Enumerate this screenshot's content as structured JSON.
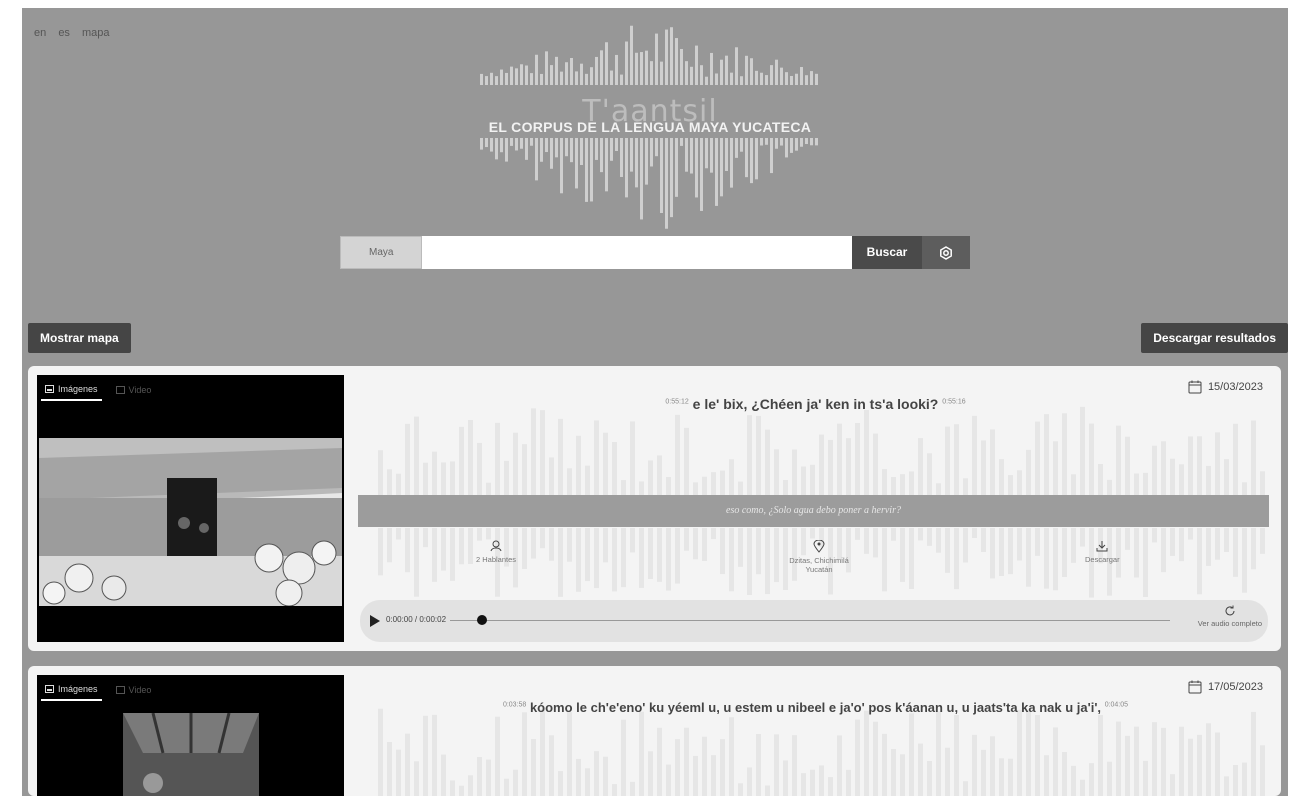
{
  "nav": {
    "items": [
      "en",
      "es",
      "mapa"
    ]
  },
  "header": {
    "logo_name": "T'aantsil",
    "logo_subtitle": "EL CORPUS DE LA LENGUA MAYA YUCATECA"
  },
  "search": {
    "language": "Maya",
    "query": "",
    "search_label": "Buscar",
    "settings_icon": "settings-icon"
  },
  "actions": {
    "show_map": "Mostrar mapa",
    "download_results": "Descargar resultados"
  },
  "results": [
    {
      "tabs": [
        "Imágenes",
        "Video"
      ],
      "date": "15/03/2023",
      "start_time": "0:55:12",
      "end_time": "0:55:16",
      "sentence": "e le' bix, ¿Chéen ja' ken in ts'a looki?",
      "translation": "eso como, ¿Solo agua debo poner a hervir?",
      "speakers": "2 Hablantes",
      "location_line1": "Dzitas, Chichimilá",
      "location_line2": "Yucatán",
      "download_label": "Descargar",
      "player_time": "0:00:00 / 0:00:02",
      "full_audio_label": "Ver audio completo"
    },
    {
      "tabs": [
        "Imágenes",
        "Video"
      ],
      "date": "17/05/2023",
      "start_time": "0:03:58",
      "end_time": "0:04:05",
      "sentence": "kóomo le ch'e'eno' ku yéeml u, u estem u nibeel e ja'o' pos k'áanan u, u jaats'ta ka nak u ja'i',"
    }
  ]
}
